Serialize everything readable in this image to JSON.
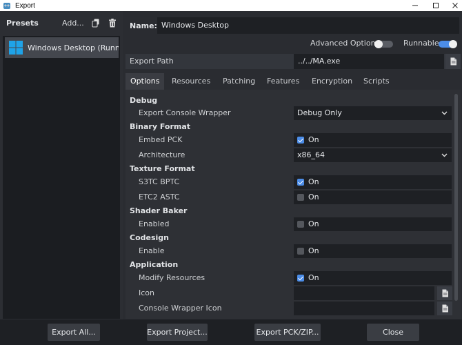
{
  "window": {
    "title": "Export"
  },
  "presets": {
    "label": "Presets",
    "add_label": "Add...",
    "items": [
      {
        "label": "Windows Desktop (Runnable)"
      }
    ]
  },
  "form": {
    "name_label": "Name:",
    "name_value": "Windows Desktop",
    "advanced_label": "Advanced Options",
    "advanced_on": false,
    "runnable_label": "Runnable",
    "runnable_on": true,
    "export_path_label": "Export Path",
    "export_path_value": "../../MA.exe"
  },
  "tabs": [
    "Options",
    "Resources",
    "Patching",
    "Features",
    "Encryption",
    "Scripts"
  ],
  "options": {
    "debug": "Debug",
    "export_console_wrapper": "Export Console Wrapper",
    "export_console_wrapper_value": "Debug Only",
    "binary_format": "Binary Format",
    "embed_pck": "Embed PCK",
    "embed_pck_checked": true,
    "architecture": "Architecture",
    "architecture_value": "x86_64",
    "texture_format": "Texture Format",
    "s3tc_bptc": "S3TC BPTC",
    "s3tc_bptc_checked": true,
    "etc2_astc": "ETC2 ASTC",
    "etc2_astc_checked": false,
    "shader_baker": "Shader Baker",
    "enabled": "Enabled",
    "enabled_checked": false,
    "codesign": "Codesign",
    "enable": "Enable",
    "enable_checked": false,
    "application": "Application",
    "modify_resources": "Modify Resources",
    "modify_resources_checked": true,
    "icon": "Icon",
    "console_wrapper_icon": "Console Wrapper Icon",
    "on_text": "On"
  },
  "footer": {
    "export_all": "Export All...",
    "export_project": "Export Project...",
    "export_pck": "Export PCK/ZIP...",
    "close": "Close"
  },
  "colors": {
    "accent": "#4c8de8",
    "panel": "#2a2c31",
    "field": "#1e2024"
  }
}
